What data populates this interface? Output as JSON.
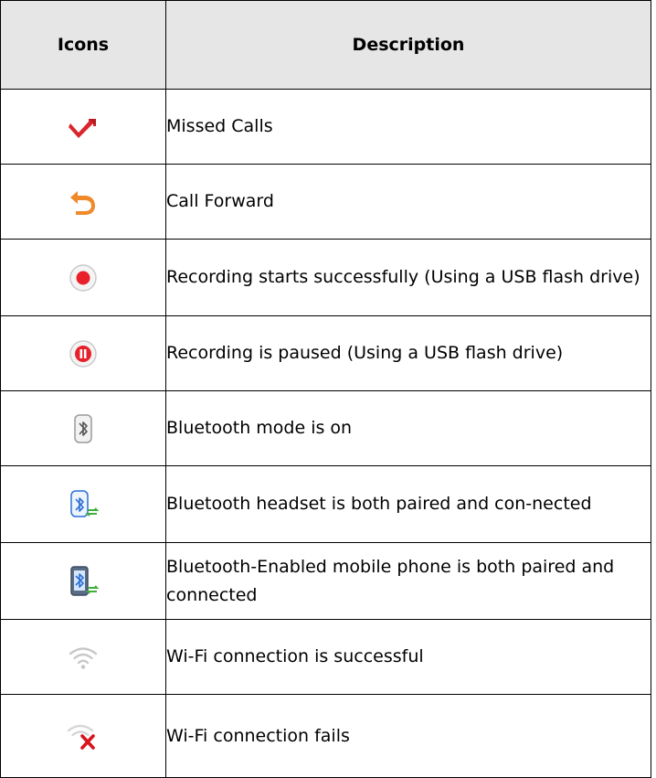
{
  "table": {
    "headers": {
      "icons": "Icons",
      "description": "Description"
    },
    "rows": [
      {
        "icon": "missed-calls-icon",
        "description": "Missed Calls"
      },
      {
        "icon": "call-forward-icon",
        "description": "Call Forward"
      },
      {
        "icon": "recording-icon",
        "description": "Recording starts successfully (Using a USB flash drive)"
      },
      {
        "icon": "recording-paused-icon",
        "description": "Recording is paused (Using a USB flash drive)"
      },
      {
        "icon": "bluetooth-icon",
        "description": "Bluetooth mode is on"
      },
      {
        "icon": "bluetooth-headset-connected-icon",
        "description": "Bluetooth headset is both paired and con-nected"
      },
      {
        "icon": "bluetooth-mobile-connected-icon",
        "description": "Bluetooth-Enabled mobile phone is both paired and connected"
      },
      {
        "icon": "wifi-icon",
        "description": "Wi-Fi connection is successful"
      },
      {
        "icon": "wifi-failed-icon",
        "description": "Wi-Fi connection fails"
      }
    ]
  },
  "colors": {
    "header_background": "#e6e6e6",
    "missed_red": "#d9262c",
    "forward_orange": "#f0892a",
    "record_red": "#e8202a",
    "bluetooth_blue": "#2a6fd6",
    "connected_green": "#3fae3a",
    "wifi_gray": "#c8c8c8",
    "fail_red": "#d8141c"
  }
}
